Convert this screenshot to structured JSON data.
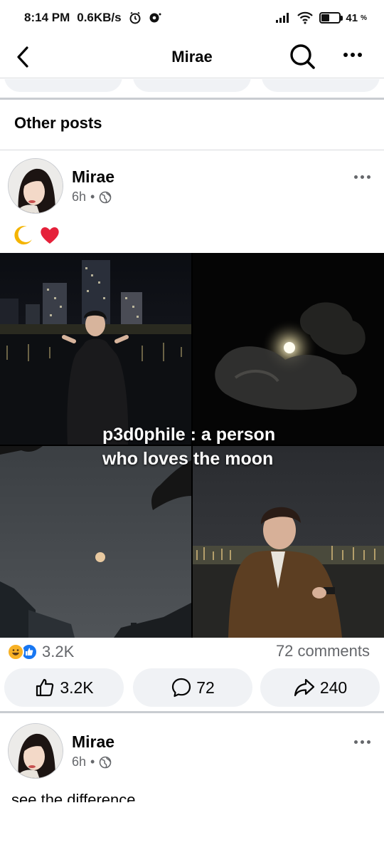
{
  "status_bar": {
    "time": "8:14 PM",
    "speed": "0.6KB/s",
    "battery": "41"
  },
  "header": {
    "title": "Mirae",
    "back_icon": "chevron-left-icon",
    "search_icon": "search-icon",
    "more_icon": "more-horizontal-icon"
  },
  "section": {
    "title": "Other posts"
  },
  "post1": {
    "author": "Mirae",
    "time": "6h",
    "separator": "•",
    "privacy_icon": "globe-icon",
    "text_emojis": [
      "crescent-moon-emoji",
      "red-heart-emoji"
    ],
    "image_overlay_line1": "p3d0phile : a person",
    "image_overlay_line2": "who loves the moon",
    "reaction_count": "3.2K",
    "comments": "72 comments",
    "actions": {
      "like_count": "3.2K",
      "comment_count": "72",
      "share_count": "240"
    }
  },
  "post2": {
    "author": "Mirae",
    "time": "6h",
    "separator": "•",
    "text": "see the difference"
  },
  "colors": {
    "secondary_text": "#65676b",
    "pill_bg": "#f0f2f5",
    "like_blue": "#1877f2"
  }
}
